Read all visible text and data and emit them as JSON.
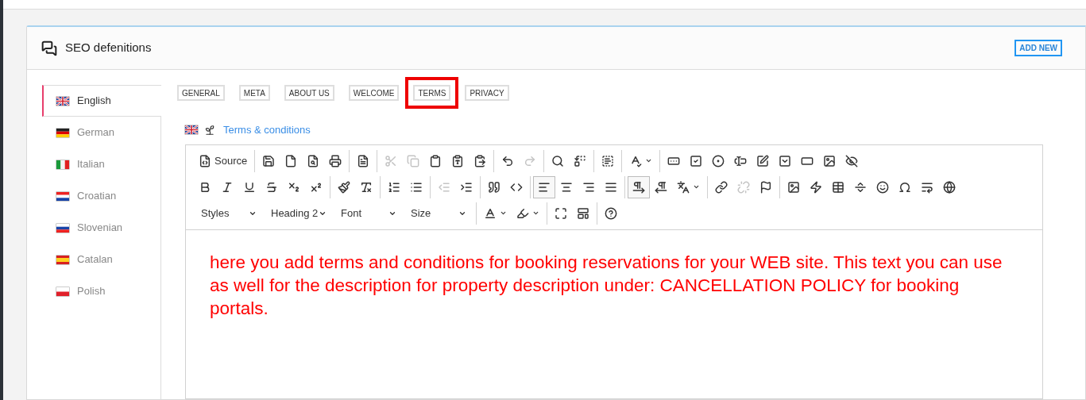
{
  "panel": {
    "title": "SEO defenitions",
    "add_button": "ADD NEW"
  },
  "languages": [
    {
      "name": "English",
      "kind": "gb",
      "selected": true
    },
    {
      "name": "German",
      "kind": "de",
      "selected": false
    },
    {
      "name": "Italian",
      "kind": "it",
      "selected": false
    },
    {
      "name": "Croatian",
      "kind": "hr",
      "selected": false
    },
    {
      "name": "Slovenian",
      "kind": "si",
      "selected": false
    },
    {
      "name": "Catalan",
      "kind": "es",
      "selected": false
    },
    {
      "name": "Polish",
      "kind": "pl",
      "selected": false
    }
  ],
  "tabs": [
    {
      "label": "GENERAL",
      "highlighted": false
    },
    {
      "label": "META",
      "highlighted": false
    },
    {
      "label": "ABOUT US",
      "highlighted": false
    },
    {
      "label": "WELCOME",
      "highlighted": false
    },
    {
      "label": "TERMS",
      "highlighted": true
    },
    {
      "label": "PRIVACY",
      "highlighted": false
    }
  ],
  "section_title": {
    "text": "Terms & conditions"
  },
  "toolbar": [
    [
      [
        {
          "kind": "source",
          "label": "Source",
          "disabled": false,
          "selected": false
        }
      ],
      [
        {
          "kind": "save",
          "disabled": false,
          "selected": false
        },
        {
          "kind": "new-page",
          "disabled": false,
          "selected": false
        },
        {
          "kind": "preview",
          "disabled": false,
          "selected": false
        },
        {
          "kind": "print",
          "disabled": false,
          "selected": false
        }
      ],
      [
        {
          "kind": "templates",
          "disabled": false,
          "selected": false
        }
      ],
      [
        {
          "kind": "cut",
          "disabled": true,
          "selected": false
        },
        {
          "kind": "copy",
          "disabled": true,
          "selected": false
        },
        {
          "kind": "paste",
          "disabled": false,
          "selected": false
        },
        {
          "kind": "paste-text",
          "disabled": false,
          "selected": false
        },
        {
          "kind": "paste-word",
          "disabled": false,
          "selected": false
        }
      ],
      [
        {
          "kind": "undo",
          "disabled": false,
          "selected": false
        },
        {
          "kind": "redo",
          "disabled": true,
          "selected": false
        }
      ],
      [
        {
          "kind": "find",
          "disabled": false,
          "selected": false
        },
        {
          "kind": "replace",
          "disabled": false,
          "selected": false
        }
      ],
      [
        {
          "kind": "select-all",
          "disabled": false,
          "selected": false
        }
      ],
      [
        {
          "kind": "spellcheck",
          "disabled": false,
          "selected": false
        }
      ],
      [
        {
          "kind": "form",
          "disabled": false,
          "selected": false
        },
        {
          "kind": "checkbox",
          "disabled": false,
          "selected": false
        },
        {
          "kind": "radio",
          "disabled": false,
          "selected": false
        },
        {
          "kind": "text-field",
          "disabled": false,
          "selected": false
        },
        {
          "kind": "textarea",
          "disabled": false,
          "selected": false
        },
        {
          "kind": "select",
          "disabled": false,
          "selected": false
        },
        {
          "kind": "button",
          "disabled": false,
          "selected": false
        },
        {
          "kind": "image-button",
          "disabled": false,
          "selected": false
        },
        {
          "kind": "hidden-field",
          "disabled": false,
          "selected": false
        }
      ]
    ],
    [
      [
        {
          "kind": "bold",
          "disabled": false,
          "selected": false
        },
        {
          "kind": "italic",
          "disabled": false,
          "selected": false
        },
        {
          "kind": "underline",
          "disabled": false,
          "selected": false
        },
        {
          "kind": "strike",
          "disabled": false,
          "selected": false
        },
        {
          "kind": "subscript",
          "disabled": false,
          "selected": false
        },
        {
          "kind": "superscript",
          "disabled": false,
          "selected": false
        }
      ],
      [
        {
          "kind": "copy-format",
          "disabled": false,
          "selected": false
        },
        {
          "kind": "remove-format",
          "disabled": false,
          "selected": false
        }
      ],
      [
        {
          "kind": "numbered-list",
          "disabled": false,
          "selected": false
        },
        {
          "kind": "bulleted-list",
          "disabled": false,
          "selected": false
        }
      ],
      [
        {
          "kind": "outdent",
          "disabled": true,
          "selected": false
        },
        {
          "kind": "indent",
          "disabled": false,
          "selected": false
        }
      ],
      [
        {
          "kind": "blockquote",
          "disabled": false,
          "selected": false
        },
        {
          "kind": "div",
          "disabled": false,
          "selected": false
        }
      ],
      [
        {
          "kind": "align-left",
          "disabled": false,
          "selected": true
        },
        {
          "kind": "align-center",
          "disabled": false,
          "selected": false
        },
        {
          "kind": "align-right",
          "disabled": false,
          "selected": false
        },
        {
          "kind": "justify",
          "disabled": false,
          "selected": false
        }
      ],
      [
        {
          "kind": "ltr",
          "disabled": false,
          "selected": true
        },
        {
          "kind": "rtl",
          "disabled": false,
          "selected": false
        },
        {
          "kind": "language",
          "disabled": false,
          "selected": false
        }
      ],
      [
        {
          "kind": "link",
          "disabled": false,
          "selected": false
        },
        {
          "kind": "unlink",
          "disabled": true,
          "selected": false
        },
        {
          "kind": "anchor",
          "disabled": false,
          "selected": false
        }
      ],
      [
        {
          "kind": "image",
          "disabled": false,
          "selected": false
        },
        {
          "kind": "flash",
          "disabled": false,
          "selected": false
        },
        {
          "kind": "table",
          "disabled": false,
          "selected": false
        },
        {
          "kind": "horizontal-rule",
          "disabled": false,
          "selected": false
        },
        {
          "kind": "smiley",
          "disabled": false,
          "selected": false
        },
        {
          "kind": "special-char",
          "disabled": false,
          "selected": false
        },
        {
          "kind": "page-break",
          "disabled": false,
          "selected": false
        },
        {
          "kind": "iframe",
          "disabled": false,
          "selected": false
        }
      ]
    ],
    [
      [
        {
          "kind": "combo",
          "label": "Styles",
          "disabled": false,
          "selected": false
        },
        {
          "kind": "combo",
          "label": "Heading 2",
          "disabled": false,
          "selected": false
        },
        {
          "kind": "combo",
          "label": "Font",
          "disabled": false,
          "selected": false
        },
        {
          "kind": "combo",
          "label": "Size",
          "disabled": false,
          "selected": false
        }
      ],
      [
        {
          "kind": "text-color",
          "disabled": false,
          "selected": false
        },
        {
          "kind": "bg-color",
          "disabled": false,
          "selected": false
        }
      ],
      [
        {
          "kind": "maximize",
          "disabled": false,
          "selected": false
        },
        {
          "kind": "show-blocks",
          "disabled": false,
          "selected": false
        }
      ],
      [
        {
          "kind": "about",
          "disabled": false,
          "selected": false
        }
      ]
    ]
  ],
  "content": "here you add terms and conditions for booking reservations for your WEB site. This text you can use as well for the description for property description under: CANCELLATION POLICY for booking portals."
}
